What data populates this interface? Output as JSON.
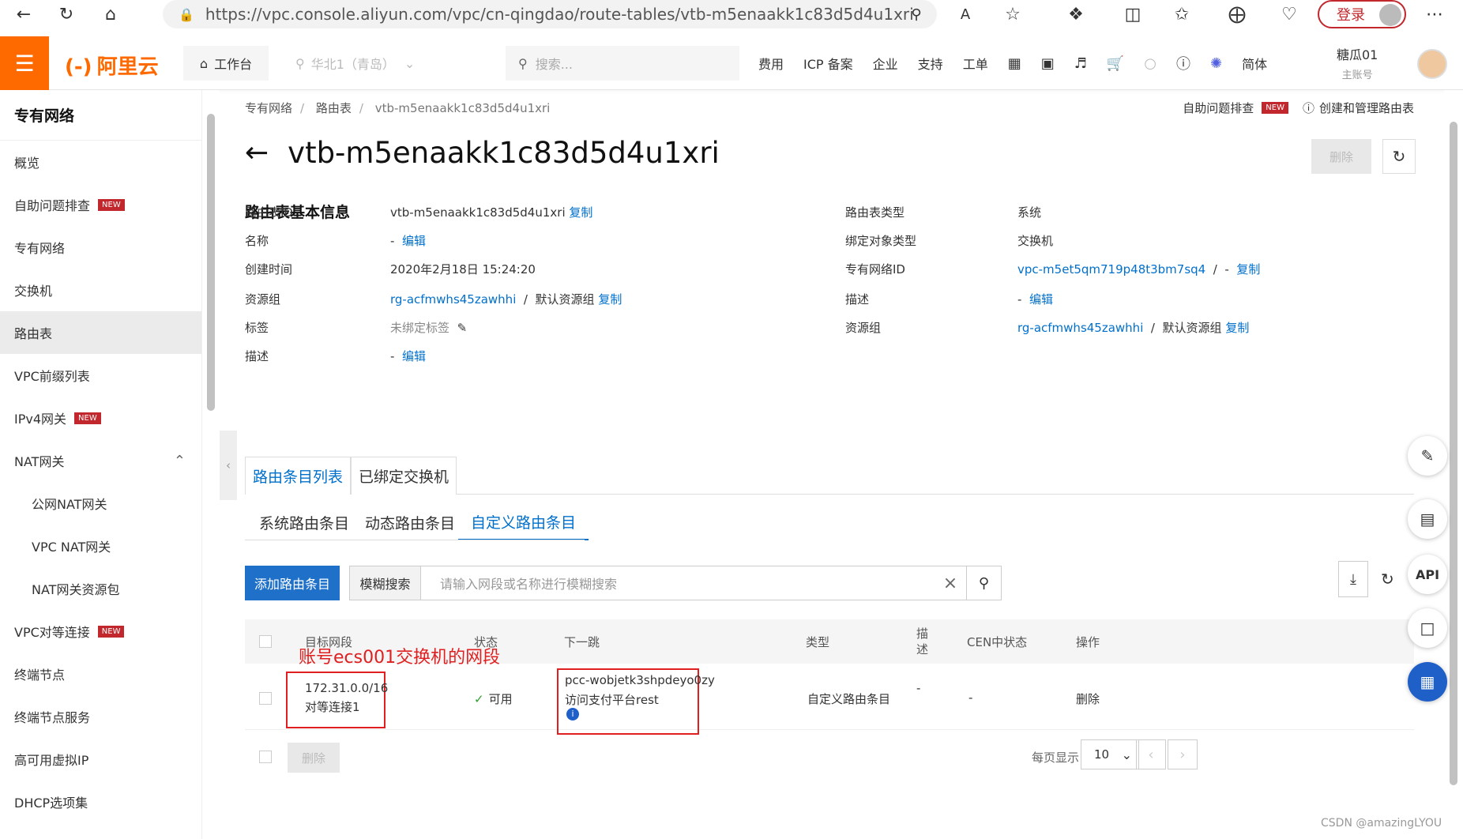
{
  "browser": {
    "url": "https://vpc.console.aliyun.com/vpc/cn-qingdao/route-tables/vtb-m5enaakk1c83d5d4u1xri",
    "login": "登录"
  },
  "header": {
    "logo": "阿里云",
    "workspace": "工作台",
    "region": "华北1（青岛）",
    "search_placeholder": "搜索...",
    "nav": [
      "费用",
      "ICP 备案",
      "企业",
      "支持",
      "工单"
    ],
    "lang": "简体",
    "user_name": "糖瓜01",
    "user_role": "主账号"
  },
  "sidebar": {
    "title": "专有网络",
    "items": [
      {
        "label": "概览",
        "new": ""
      },
      {
        "label": "自助问题排查",
        "new": "NEW"
      },
      {
        "label": "专有网络",
        "new": ""
      },
      {
        "label": "交换机",
        "new": ""
      },
      {
        "label": "路由表",
        "new": ""
      },
      {
        "label": "VPC前缀列表",
        "new": ""
      },
      {
        "label": "IPv4网关",
        "new": "NEW"
      },
      {
        "label": "NAT网关",
        "new": ""
      },
      {
        "label": "公网NAT网关",
        "new": ""
      },
      {
        "label": "VPC NAT网关",
        "new": ""
      },
      {
        "label": "NAT网关资源包",
        "new": ""
      },
      {
        "label": "VPC对等连接",
        "new": "NEW"
      },
      {
        "label": "终端节点",
        "new": ""
      },
      {
        "label": "终端节点服务",
        "new": ""
      },
      {
        "label": "高可用虚拟IP",
        "new": ""
      },
      {
        "label": "DHCP选项集",
        "new": ""
      }
    ]
  },
  "breadcrumb": [
    "专有网络",
    "路由表",
    "vtb-m5enaakk1c83d5d4u1xri"
  ],
  "top_right": {
    "troubleshoot": "自助问题排查",
    "new": "NEW",
    "manage": "创建和管理路由表"
  },
  "page": {
    "title": "vtb-m5enaakk1c83d5d4u1xri",
    "delete": "删除",
    "section": "路由表基本信息"
  },
  "info_left": {
    "id_label": "路由表ID",
    "id_value": "vtb-m5enaakk1c83d5d4u1xri",
    "copy": "复制",
    "name_label": "名称",
    "name_value": "-",
    "edit": "编辑",
    "created_label": "创建时间",
    "created_value": "2020年2月18日 15:24:20",
    "rg_label": "资源组",
    "rg_value": "rg-acfmwhs45zawhhi",
    "rg_sep": "/",
    "rg_default": "默认资源组",
    "tag_label": "标签",
    "tag_value": "未绑定标签",
    "desc_label": "描述",
    "desc_value": "-"
  },
  "info_right": {
    "type_label": "路由表类型",
    "type_value": "系统",
    "bind_label": "绑定对象类型",
    "bind_value": "交换机",
    "vpc_label": "专有网络ID",
    "vpc_value": "vpc-m5et5qm719p48t3bm7sq4",
    "vpc_sep": "/",
    "vpc_dash": "-",
    "desc_label": "描述",
    "desc_value": "-",
    "rg_label": "资源组",
    "rg_value": "rg-acfmwhs45zawhhi",
    "rg_default": "默认资源组"
  },
  "tabs": [
    "路由条目列表",
    "已绑定交换机"
  ],
  "subtabs": [
    "系统路由条目",
    "动态路由条目",
    "自定义路由条目"
  ],
  "toolbar": {
    "add": "添加路由条目",
    "fuzzy": "模糊搜索",
    "placeholder": "请输入网段或名称进行模糊搜索"
  },
  "table": {
    "headers": [
      "目标网段",
      "状态",
      "下一跳",
      "类型",
      "描述",
      "CEN中状态",
      "操作"
    ],
    "rows": [
      {
        "cidr": "172.31.0.0/16",
        "name": "对等连接1",
        "status": "可用",
        "next_hop": "pcc-wobjetk3shpdeyo0zy",
        "next_hop_name": "访问支付平台rest",
        "type": "自定义路由条目",
        "desc": "-",
        "cen": "-",
        "action": "删除"
      }
    ]
  },
  "annotation": "账号ecs001交换机的网段",
  "footer": {
    "delete": "删除",
    "per_page_label": "每页显示",
    "per_page": "10"
  },
  "watermark": "CSDN @amazingLYOU"
}
